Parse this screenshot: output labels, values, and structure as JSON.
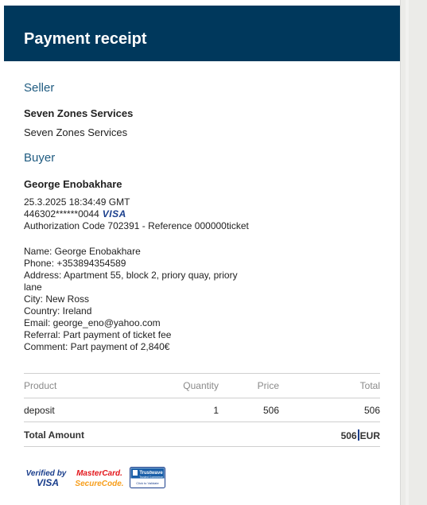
{
  "header": {
    "title": "Payment receipt"
  },
  "seller": {
    "section_title": "Seller",
    "name_bold": "Seven Zones Services",
    "name": "Seven Zones Services"
  },
  "buyer": {
    "section_title": "Buyer",
    "name": "George Enobakhare",
    "datetime": "25.3.2025 18:34:49 GMT",
    "card_number": "446302******0044",
    "card_brand": "VISA",
    "authorization": "Authorization Code 702391 - Reference 000000ticket",
    "details": [
      "Name: George Enobakhare",
      "Phone: +353894354589",
      "Address: Apartment 55, block 2, priory quay, priory",
      "lane",
      "City: New Ross",
      "Country: Ireland",
      "Email: george_eno@yahoo.com",
      "Referral: Part payment of ticket fee",
      "Comment: Part payment of 2,840€"
    ]
  },
  "table": {
    "headers": {
      "product": "Product",
      "quantity": "Quantity",
      "price": "Price",
      "total": "Total"
    },
    "rows": [
      {
        "product": "deposit",
        "quantity": "1",
        "price": "506",
        "total": "506"
      }
    ],
    "total_label": "Total Amount",
    "total_value": "506",
    "total_currency": "EUR"
  },
  "badges": {
    "verified_by_top": "Verified by",
    "verified_by_bottom": "VISA",
    "mastercard_top": "MasterCard.",
    "mastercard_bottom": "SecureCode.",
    "trustwave_title": "Trustwave",
    "trustwave_sub": "Trusted Commerce",
    "trustwave_click": "Click to Validate"
  },
  "colors": {
    "header_bg": "#00385c",
    "section_title": "#1f5b80",
    "visa_blue": "#1a3e8c",
    "mastercard_red": "#e3161b",
    "mastercard_orange": "#f79e1b"
  }
}
